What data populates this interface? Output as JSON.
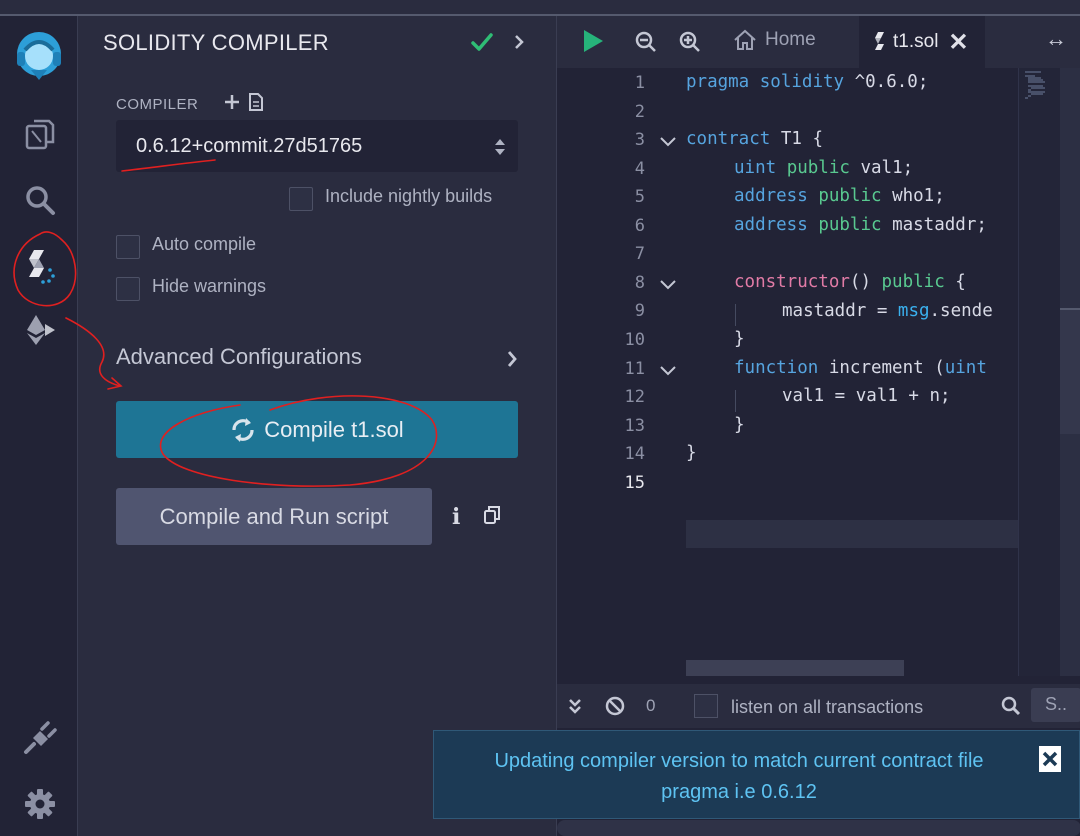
{
  "panel": {
    "title": "SOLIDITY COMPILER",
    "compiler_label": "COMPILER",
    "compiler_version": "0.6.12+commit.27d51765",
    "include_nightly_label": "Include nightly builds",
    "auto_compile_label": "Auto compile",
    "hide_warnings_label": "Hide warnings",
    "advanced_label": "Advanced Configurations",
    "compile_button": "Compile t1.sol",
    "run_script_button": "Compile and Run script"
  },
  "rail": {
    "icons": [
      "remix-logo-icon",
      "file-explorer-icon",
      "search-icon",
      "solidity-compiler-icon",
      "deploy-run-icon",
      "plugin-manager-icon",
      "settings-icon"
    ]
  },
  "editor": {
    "tabs": [
      {
        "label": "Home",
        "icon": "home-icon"
      },
      {
        "label": "t1.sol",
        "icon": "solidity-icon",
        "active": true
      }
    ],
    "line_numbers": [
      "1",
      "2",
      "3",
      "4",
      "5",
      "6",
      "7",
      "8",
      "9",
      "10",
      "11",
      "12",
      "13",
      "14",
      "15"
    ],
    "code": {
      "l1_a": "pragma",
      "l1_b": "solidity",
      "l1_c": " ^0.6.0;",
      "l3_a": "contract",
      "l3_b": " T1 {",
      "l4_a": "uint",
      "l4_b": "public",
      "l4_c": " val1;",
      "l5_a": "address",
      "l5_b": "public",
      "l5_c": " who1;",
      "l6_a": "address",
      "l6_b": "public",
      "l6_c": " mastaddr;",
      "l8_a": "constructor",
      "l8_b": "() ",
      "l8_c": "public",
      "l8_d": " {",
      "l9_a": "mastaddr = ",
      "l9_b": "msg",
      "l9_c": ".sende",
      "l10": "}",
      "l11_a": "function",
      "l11_b": " increment (",
      "l11_c": "uint",
      "l12": "val1 = val1 + n;",
      "l13": "}",
      "l14": "}"
    }
  },
  "terminal": {
    "count": "0",
    "listen_label": "listen on all transactions",
    "search_placeholder": "S.."
  },
  "toast": {
    "line1": "Updating compiler version to match current contract file",
    "line2": "pragma i.e 0.6.12"
  },
  "colors": {
    "accent_compile": "#1e7595",
    "check_green": "#2fbd75",
    "run_green": "#26b37a",
    "toast_text": "#5ec3f2",
    "annotation_red": "#e02020"
  }
}
